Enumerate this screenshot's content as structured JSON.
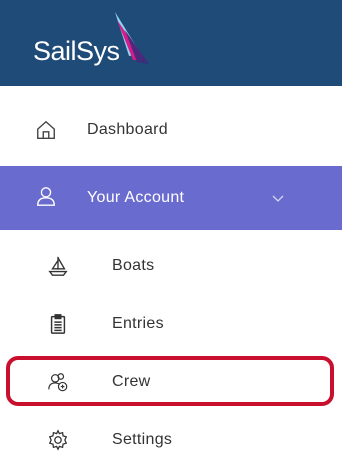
{
  "header": {
    "logo_text": "SailSys",
    "logo_icon": "sail-logo-icon",
    "background_color": "#1f4b78"
  },
  "nav": {
    "dashboard": {
      "label": "Dashboard",
      "icon": "home-icon"
    },
    "account": {
      "label": "Your Account",
      "icon": "user-icon",
      "expand_icon": "chevron-down-icon",
      "active_color": "#6a6bcf"
    },
    "boats": {
      "label": "Boats",
      "icon": "sailboat-icon"
    },
    "entries": {
      "label": "Entries",
      "icon": "clipboard-icon"
    },
    "crew": {
      "label": "Crew",
      "icon": "crew-add-icon"
    },
    "settings": {
      "label": "Settings",
      "icon": "gear-icon"
    }
  },
  "annotation": {
    "color": "#c8102e"
  }
}
